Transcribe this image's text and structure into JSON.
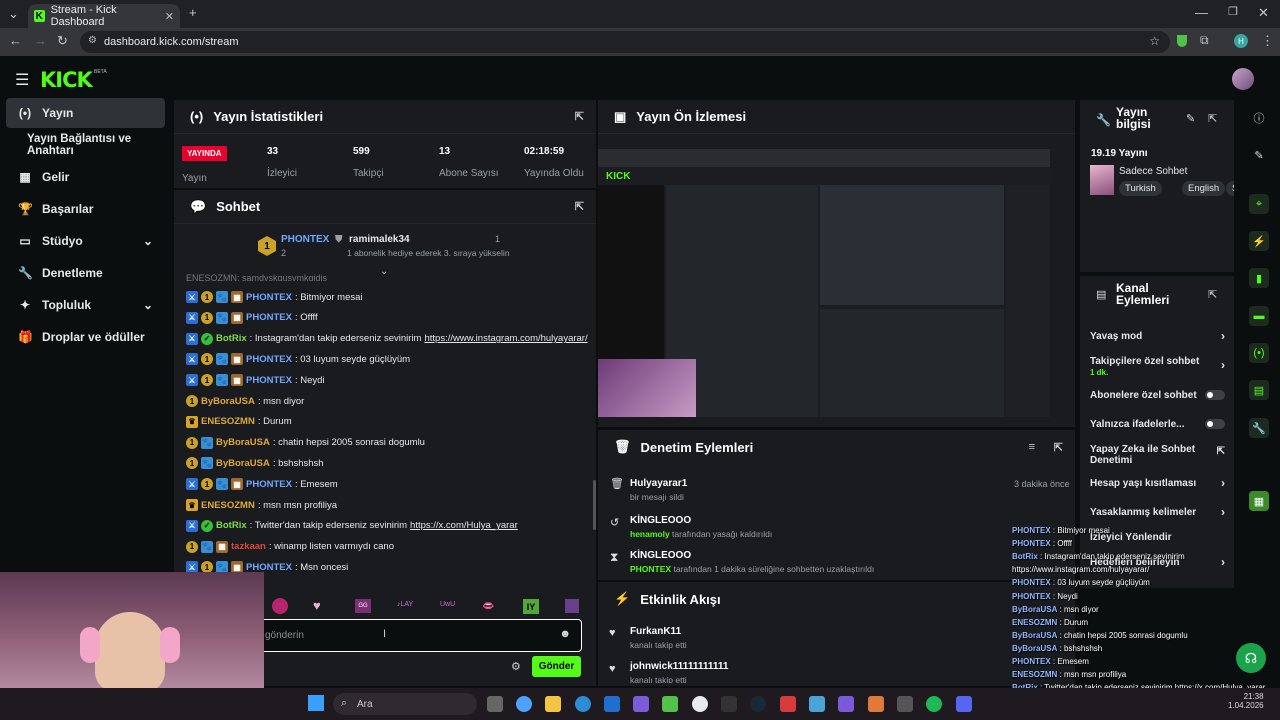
{
  "browser": {
    "tab_title": "Stream - Kick Dashboard",
    "url": "dashboard.kick.com/stream",
    "profile_initial": "H"
  },
  "header": {
    "logo": "KICK",
    "beta": "BETA"
  },
  "sidebar": {
    "items": [
      {
        "label": "Yayın",
        "icon": "broadcast-icon"
      },
      {
        "label": "Yayın Bağlantısı ve Anahtarı"
      },
      {
        "label": "Gelir",
        "icon": "wallet-icon"
      },
      {
        "label": "Başarılar",
        "icon": "trophy-icon"
      },
      {
        "label": "Stüdyo",
        "icon": "studio-icon"
      },
      {
        "label": "Denetleme",
        "icon": "wrench-icon"
      },
      {
        "label": "Topluluk",
        "icon": "community-icon"
      },
      {
        "label": "Droplar ve ödüller",
        "icon": "gift-icon"
      }
    ]
  },
  "stats": {
    "title": "Yayın İstatistikleri",
    "live_badge": "YAYINDA",
    "live_label": "Yayın",
    "viewers": "33",
    "viewers_label": "İzleyici",
    "followers": "599",
    "followers_label": "Takipçi",
    "subs": "13",
    "subs_label": "Abone Sayısı",
    "duration": "02:18:59",
    "duration_label": "Yayında Olduğu Süre"
  },
  "chat": {
    "title": "Sohbet",
    "pinned_user": "PHONTEX",
    "pinned_user2": "ramimalek34",
    "pinned_count1": "2",
    "pinned_count2": "1",
    "pinned_text": "1 abonelik hediye ederek 3. sıraya yükselin",
    "cut_line": "ENESOZMN: samdvskqusvmkqjdis",
    "messages": [
      {
        "user": "PHONTEX",
        "text": ": Bitmiyor mesai",
        "color": "#6fa8ff"
      },
      {
        "user": "PHONTEX",
        "text": ": Offff",
        "color": "#6fa8ff"
      },
      {
        "user": "BotRix",
        "text": ": Instagram'dan takip ederseniz sevinirim ",
        "link": "https://www.instagram.com/hulyayarar/",
        "color": "#7ddc4a"
      },
      {
        "user": "PHONTEX",
        "text": ": 03 luyum seyde güçlüyüm",
        "color": "#6fa8ff"
      },
      {
        "user": "PHONTEX",
        "text": ": Neydi",
        "color": "#6fa8ff"
      },
      {
        "user": "ByBoraUSA",
        "text": ": msn diyor",
        "color": "#e0a83a"
      },
      {
        "user": "ENESOZMN",
        "text": ": Durum",
        "color": "#e0a83a"
      },
      {
        "user": "ByBoraUSA",
        "text": ": chatin hepsi 2005 sonrasi dogumlu",
        "color": "#e0a83a"
      },
      {
        "user": "ByBoraUSA",
        "text": ": bshshshsh",
        "color": "#e0a83a"
      },
      {
        "user": "PHONTEX",
        "text": ": Emesem",
        "color": "#6fa8ff"
      },
      {
        "user": "ENESOZMN",
        "text": ": msn msn profiliya",
        "color": "#e0a83a"
      },
      {
        "user": "BotRix",
        "text": ": Twitter'dan takip ederseniz sevinirim ",
        "link": "https://x.com/Hulya_yarar",
        "color": "#7ddc4a"
      },
      {
        "user": "tazkaan",
        "text": ": winamp listen varmıydı cano",
        "color": "#e0463a"
      },
      {
        "user": "PHONTEX",
        "text": ": Msn oncesi",
        "color": "#6fa8ff"
      }
    ],
    "input_placeholder": "gönderin",
    "send_label": "Gönder"
  },
  "preview": {
    "title": "Yayın Ön İzlemesi"
  },
  "mod": {
    "title": "Denetim Eylemleri",
    "rows": [
      {
        "name": "Hulyayarar1",
        "detail": "bir mesajı sildi",
        "time": "3 dakika önce"
      },
      {
        "name": "KİNGLEOOO",
        "actor": "henamoly",
        "detail": " tarafından yasağı kaldırıldı"
      },
      {
        "name": "KİNGLEOOO",
        "actor": "PHONTEX",
        "detail": " tarafından 1 dakika süreliğine sohbetten uzaklaştırıldı"
      }
    ]
  },
  "activity": {
    "title": "Etkinlik Akışı",
    "rows": [
      {
        "name": "FurkanK11",
        "detail": "kanalı takip etti"
      },
      {
        "name": "johnwick11111111111",
        "detail": "kanalı takip etti"
      }
    ]
  },
  "stream_info": {
    "title": "Yayın bilgisi",
    "stream_name": "19.19 Yayını",
    "category": "Sadece Sohbet",
    "tags": [
      "Turkish",
      "English",
      "S"
    ]
  },
  "channel_actions": {
    "title": "Kanal Eylemleri",
    "items": [
      {
        "label": "Yavaş mod",
        "kind": "chevron"
      },
      {
        "label": "Takipçilere özel sohbet",
        "sub": "1 dk.",
        "kind": "chevron"
      },
      {
        "label": "Abonelere özel sohbet",
        "kind": "toggle"
      },
      {
        "label": "Yalnızca ifadelerle...",
        "kind": "toggle"
      },
      {
        "label": "Yapay Zeka ile Sohbet Denetimi",
        "kind": "external"
      },
      {
        "label": "Hesap yaşı kısıtlaması",
        "kind": "chevron"
      },
      {
        "label": "Yasaklanmış kelimeler",
        "kind": "chevron"
      },
      {
        "label": "İzleyici Yönlendir",
        "kind": "none"
      },
      {
        "label": "Hedefleri belirleyin",
        "kind": "chevron"
      }
    ]
  },
  "overlay_chat": [
    {
      "user": "PHONTEX",
      "text": " : Bitmiyor mesai"
    },
    {
      "user": "PHONTEX",
      "text": " : Offff"
    },
    {
      "user": "BotRix",
      "text": " : Instagram'dan takip ederseniz sevinirim"
    },
    {
      "user": "",
      "text": "https://www.instagram.com/hulyayarar/"
    },
    {
      "user": "PHONTEX",
      "text": " : 03 luyum seyde güçlüyüm"
    },
    {
      "user": "PHONTEX",
      "text": " : Neydi"
    },
    {
      "user": "ByBoraUSA",
      "text": " : msn diyor"
    },
    {
      "user": "ENESOZMN",
      "text": " : Durum"
    },
    {
      "user": "ByBoraUSA",
      "text": " : chatin hepsi 2005 sonrasi dogumlu"
    },
    {
      "user": "ByBoraUSA",
      "text": " : bshshshsh"
    },
    {
      "user": "PHONTEX",
      "text": " : Emesem"
    },
    {
      "user": "ENESOZMN",
      "text": " : msn msn profiliya"
    },
    {
      "user": "BotRix",
      "text": " : Twitter'dan takip ederseniz sevinirim https://x.com/Hulya_yarar"
    },
    {
      "user": "",
      "text": " : winamp listen varmıydı cano"
    }
  ],
  "taskbar": {
    "search": "Ara",
    "time": "21:38",
    "date": "1.04.2026"
  },
  "colors": {
    "accent": "#53fc18",
    "panel": "#191b1f",
    "bg": "#0b0e0f"
  }
}
